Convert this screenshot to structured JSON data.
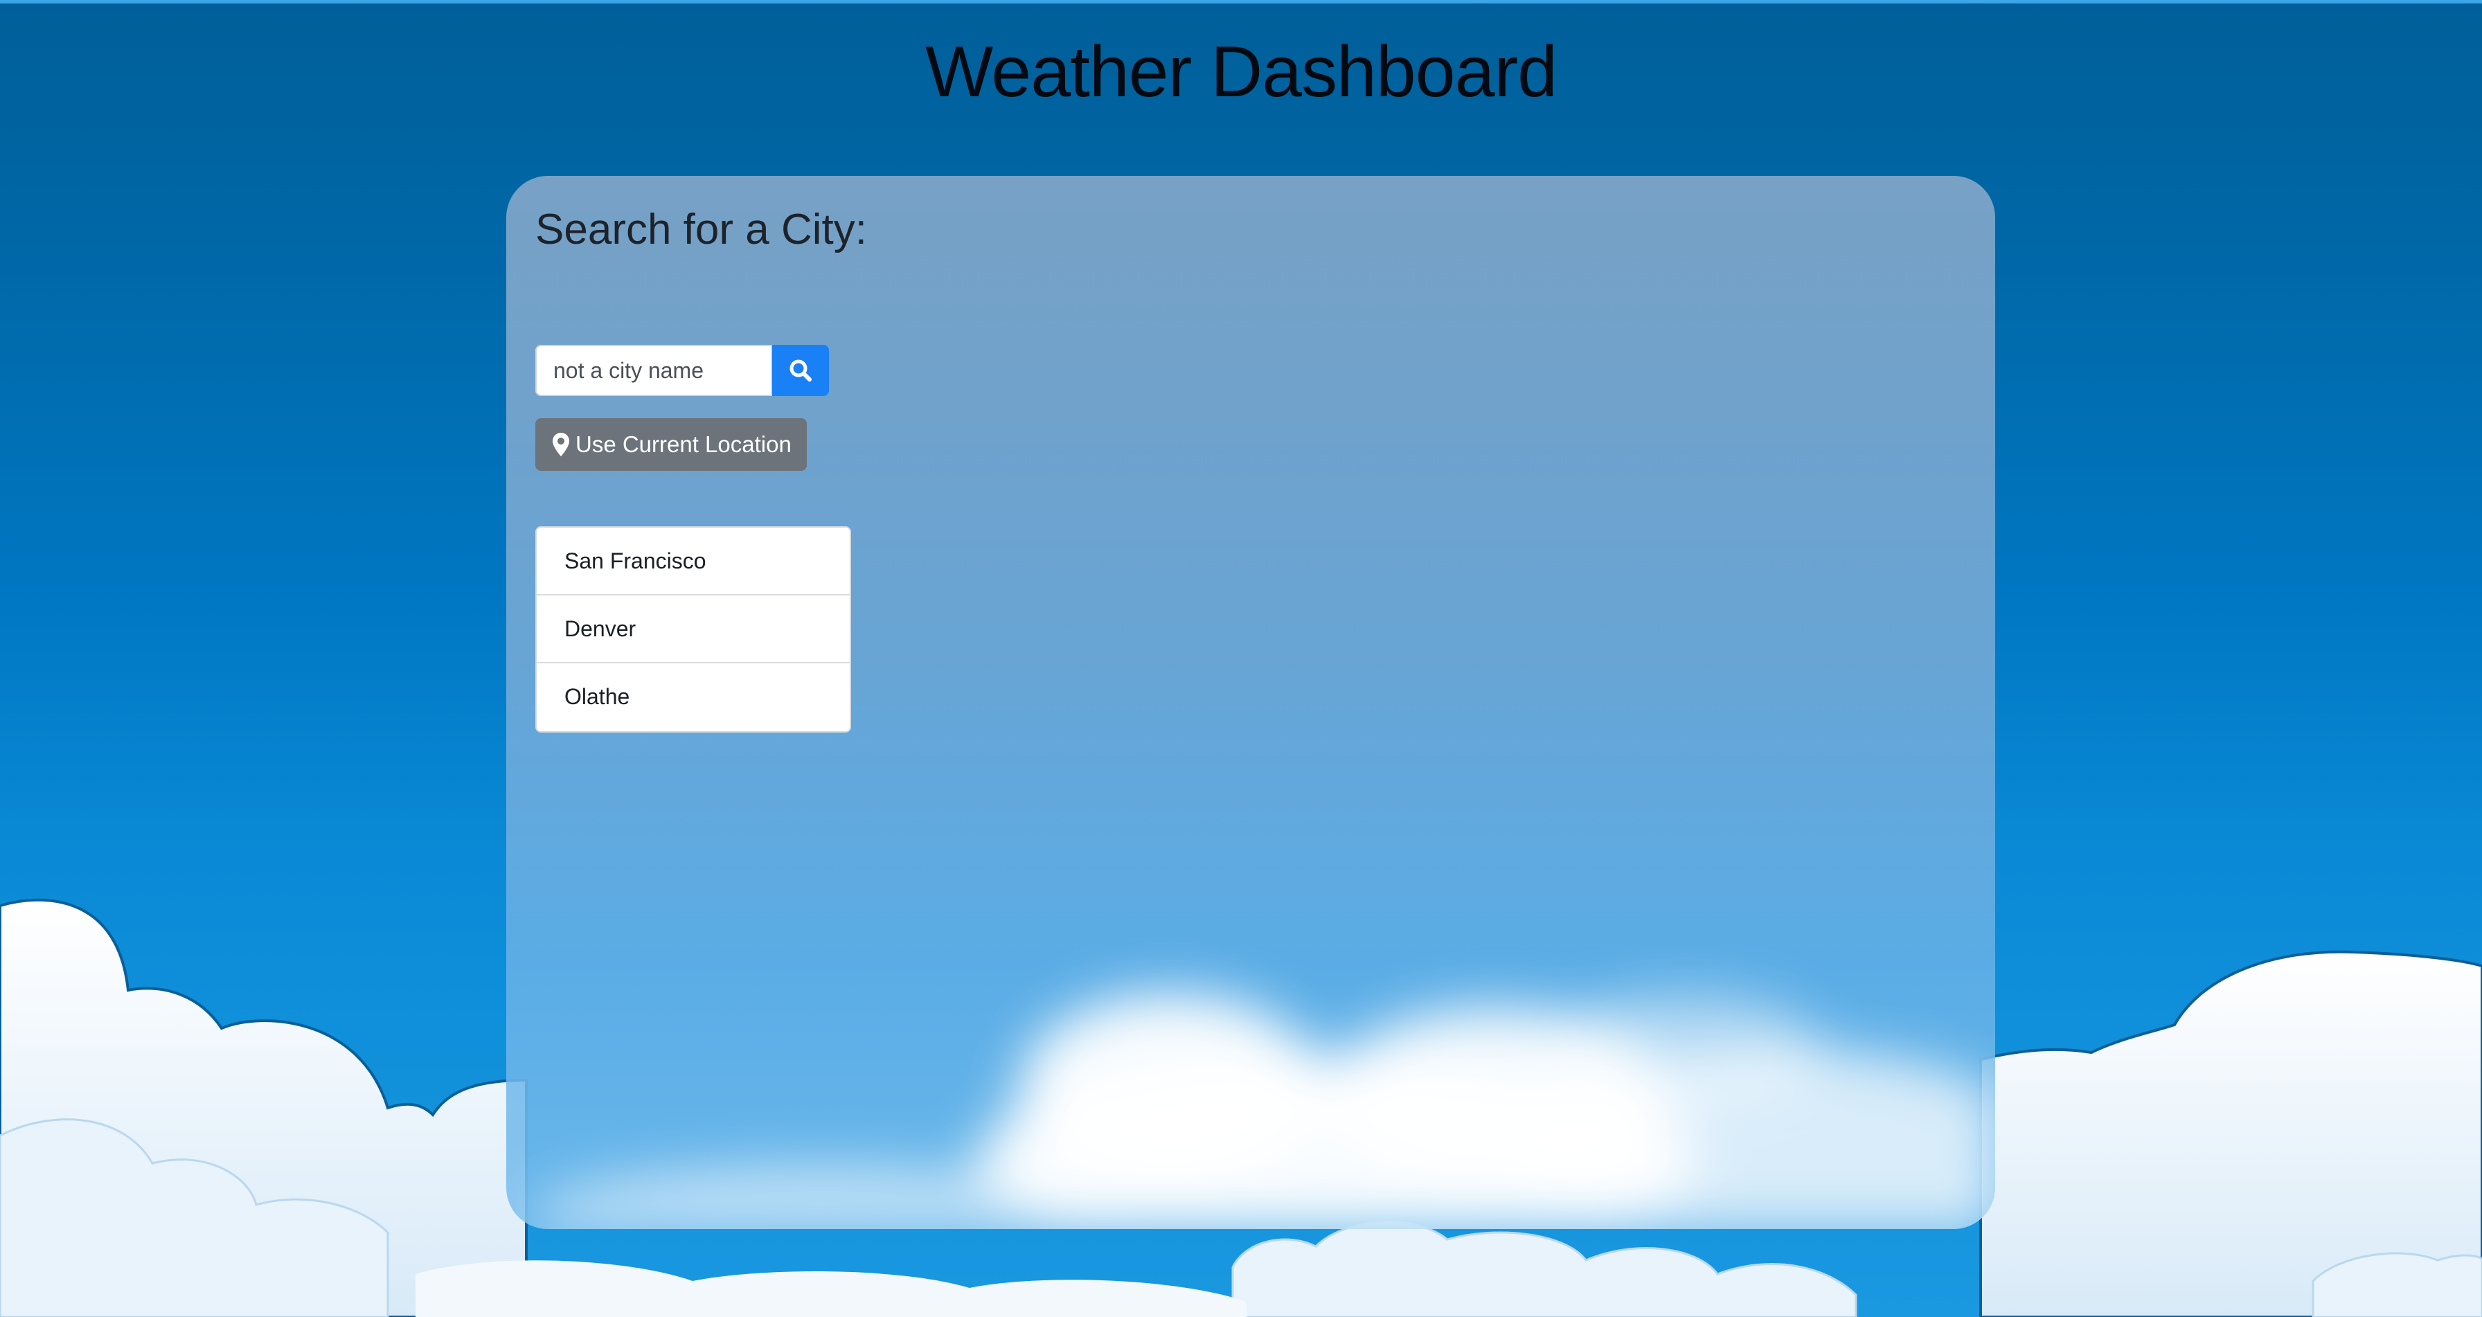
{
  "header": {
    "title": "Weather Dashboard"
  },
  "search": {
    "heading": "Search for a City:",
    "input_value": "not a city name",
    "search_button_icon": "search-icon",
    "location_button_label": "Use Current Location",
    "location_button_icon": "map-marker-icon"
  },
  "history": {
    "items": [
      {
        "label": "San Francisco"
      },
      {
        "label": "Denver"
      },
      {
        "label": "Olathe"
      }
    ]
  },
  "colors": {
    "sky_top": "#005f99",
    "sky_bottom": "#1a98e0",
    "search_button": "#1a80f5",
    "location_button": "#6c737a"
  }
}
